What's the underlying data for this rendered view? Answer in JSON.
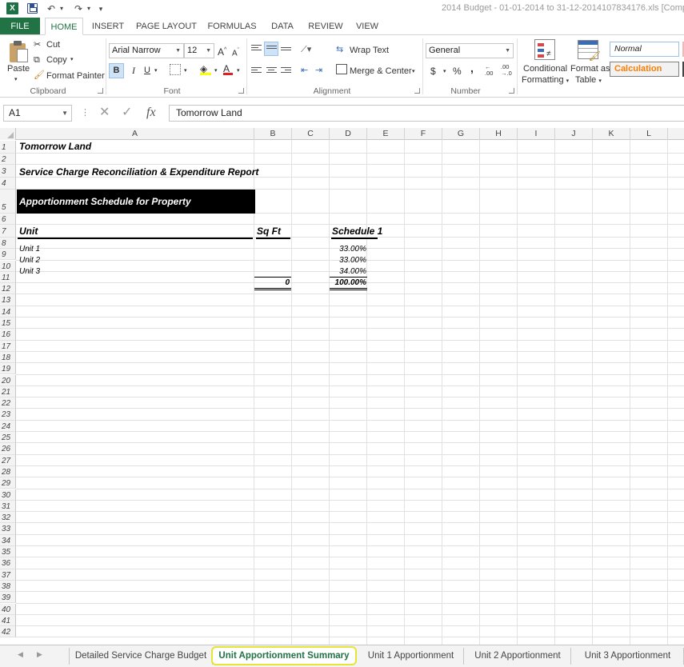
{
  "window": {
    "title": "2014 Budget - 01-01-2014 to 31-12-2014107834176.xls  [Compatibility",
    "app_logo": "X",
    "undo_icon": "undo-icon",
    "redo_icon": "redo-icon",
    "qat_more": "▾"
  },
  "ribbon_tabs": [
    "FILE",
    "HOME",
    "INSERT",
    "PAGE LAYOUT",
    "FORMULAS",
    "DATA",
    "REVIEW",
    "VIEW"
  ],
  "active_tab": "HOME",
  "ribbon": {
    "clipboard": {
      "paste": "Paste",
      "cut": "Cut",
      "copy": "Copy",
      "format_painter": "Format Painter",
      "label": "Clipboard"
    },
    "font": {
      "name": "Arial Narrow",
      "size": "12",
      "grow": "A",
      "shrink": "A",
      "bold": "B",
      "italic": "I",
      "underline": "U",
      "font_color": "A",
      "label": "Font"
    },
    "alignment": {
      "wrap_text": "Wrap Text",
      "merge_center": "Merge & Center",
      "label": "Alignment"
    },
    "number": {
      "format": "General",
      "currency": "$",
      "percent": "%",
      "comma": ",",
      "inc_decimal": ".00",
      "dec_decimal": ".0",
      "label": "Number"
    },
    "styles": {
      "conditional_1": "Conditional",
      "conditional_2": "Formatting",
      "format_table_1": "Format as",
      "format_table_2": "Table",
      "normal": "Normal",
      "calculation": "Calculation"
    },
    "colors": {
      "excel_green": "#217346",
      "calc_orange": "#fa7d00",
      "font_red": "#e02020",
      "highlight_yellow": "#ffff00"
    }
  },
  "formula_bar": {
    "name_box": "A1",
    "fx": "fx",
    "cancel": "✕",
    "enter": "✓",
    "content": "Tomorrow Land"
  },
  "columns": [
    "A",
    "B",
    "C",
    "D",
    "E",
    "F",
    "G",
    "H",
    "I",
    "J",
    "K",
    "L"
  ],
  "rows": [
    "1",
    "2",
    "3",
    "4",
    "5",
    "6",
    "7",
    "8",
    "9",
    "10",
    "11",
    "12",
    "13",
    "14",
    "15",
    "16",
    "17",
    "18",
    "19",
    "20",
    "21",
    "22",
    "23",
    "24",
    "25",
    "26",
    "27",
    "28",
    "29",
    "30",
    "31",
    "32",
    "33",
    "34",
    "35",
    "36",
    "37",
    "38",
    "39",
    "40",
    "41",
    "42"
  ],
  "sheet": {
    "title": "Tomorrow Land",
    "subtitle": "Service Charge Reconciliation & Expenditure Report",
    "schedule_header": "Apportionment Schedule for Property",
    "col_unit": "Unit",
    "col_sqft": "Sq Ft",
    "col_schedule": "Schedule 1",
    "units": [
      {
        "name": "Unit 1",
        "pct": "33.00%"
      },
      {
        "name": "Unit 2",
        "pct": "33.00%"
      },
      {
        "name": "Unit 3",
        "pct": "34.00%"
      }
    ],
    "total_sqft": "0",
    "total_pct": "100.00%"
  },
  "sheet_tabs": [
    "Detailed Service Charge Budget",
    "Unit Apportionment Summary",
    "Unit 1 Apportionment",
    "Unit 2 Apportionment",
    "Unit 3 Apportionment"
  ],
  "active_sheet": "Unit Apportionment Summary"
}
